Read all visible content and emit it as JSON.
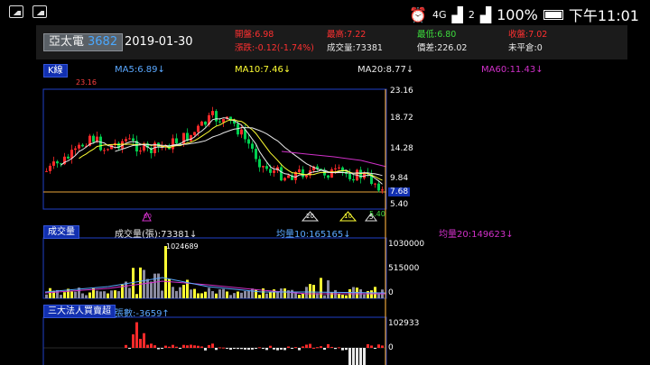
{
  "status_bar": {
    "signal_label": "4G",
    "sim_label": "2",
    "battery": "100%",
    "time": "下午11:01"
  },
  "header": {
    "stock_name": "亞太電",
    "stock_code": "3682",
    "date": "2019-01-30",
    "open": "開盤:6.98",
    "change": "漲跌:-0.12(-1.74%)",
    "high": "最高:7.22",
    "volume": "成交量:73381",
    "low": "最低:6.80",
    "bias": "價差:226.02",
    "close": "收盤:7.02",
    "uncovered": "未平倉:0"
  },
  "kline": {
    "label": "K線",
    "ma5": "MA5:6.89↓",
    "ma10": "MA10:7.46↓",
    "ma20": "MA20:8.77↓",
    "ma60": "MA60:11.43↓",
    "peak_label": "23.16",
    "low_label": "5.40",
    "axis": [
      "23.16",
      "18.72",
      "14.28",
      "9.84",
      "7.68",
      "5.40"
    ],
    "markers": [
      "60",
      "20",
      "10",
      "5"
    ]
  },
  "volume": {
    "label": "成交量",
    "vol": "成交量(張):73381↓",
    "avg10": "均量10:165165↓",
    "avg20": "均量20:149623↓",
    "peak_label": "1024689",
    "axis": [
      "1030000",
      "515000",
      "0"
    ]
  },
  "institutional": {
    "label": "三大法人買賣超",
    "count": "張數:-3659↑",
    "axis": [
      "102933",
      "0"
    ]
  },
  "colors": {
    "up": "#ff2a2a",
    "down": "#00d050",
    "ma5": "#e8e8e8",
    "ma10": "#ffff33",
    "ma20": "#e8e8e8",
    "ma60": "#d030c8",
    "grid_border": "#1f3fc8",
    "cursor": "#e8a33a"
  }
}
